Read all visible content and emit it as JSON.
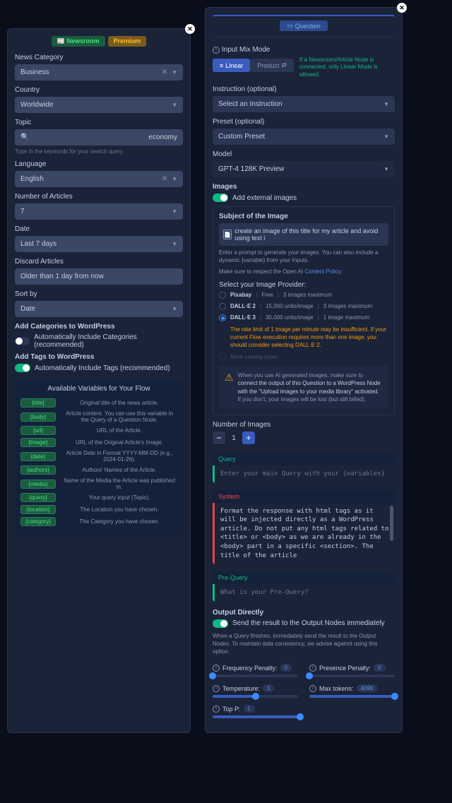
{
  "left": {
    "tabs": {
      "newsroom": "Newsroom",
      "premium": "Premium"
    },
    "category_label": "News Category",
    "category_value": "Business",
    "country_label": "Country",
    "country_value": "Worldwide",
    "topic_label": "Topic",
    "topic_value": "economy",
    "topic_help": "Type in the keywords for your search query",
    "language_label": "Language",
    "language_value": "English",
    "num_articles_label": "Number of Articles",
    "num_articles_value": "7",
    "date_label": "Date",
    "date_value": "Last 7 days",
    "discard_label": "Discard Articles",
    "discard_value": "Older than 1 day from now",
    "sort_label": "Sort by",
    "sort_value": "Date",
    "add_cat_label": "Add Categories to WordPress",
    "add_cat_toggle": "Automatically Include Categories (recommended)",
    "add_tags_label": "Add Tags to WordPress",
    "add_tags_toggle": "Automatically Include Tags (recommended)",
    "vars_title": "Available Variables for Your Flow",
    "vars": [
      {
        "name": "{title}",
        "desc": "Original title of the news article."
      },
      {
        "name": "{body}",
        "desc": "Article content. You can use this variable in the Query of a Question Node."
      },
      {
        "name": "{url}",
        "desc": "URL of the Article."
      },
      {
        "name": "{image}",
        "desc": "URL of the Original Article's Image."
      },
      {
        "name": "{date}",
        "desc": "Article Date in Format YYYY-MM-DD (e.g., 2024-01-26)."
      },
      {
        "name": "{authors}",
        "desc": "Authors' Names of the Article."
      },
      {
        "name": "{media}",
        "desc": "Name of the Media the Article was published in."
      },
      {
        "name": "{query}",
        "desc": "Your query input (Topic)."
      },
      {
        "name": "{location}",
        "desc": "The Location you have chosen."
      },
      {
        "name": "{category}",
        "desc": "The Category you have chosen."
      }
    ]
  },
  "right": {
    "header": "Question",
    "mix_label": "Input Mix Mode",
    "mode_linear": "Linear",
    "mode_product": "Product",
    "mode_note": "If a Newsroom/Article Node is connected, only Linear Mode is allowed.",
    "instruction_label": "Instruction (optional)",
    "instruction_value": "Select an Instruction",
    "preset_label": "Preset (optional)",
    "preset_value": "Custom Preset",
    "model_label": "Model",
    "model_value": "GPT-4 128K Preview",
    "images_label": "Images",
    "images_toggle": "Add external images",
    "subject_label": "Subject of the Image",
    "subject_value": "create an image of this title for my article and avoid using text i",
    "subject_help1": "Enter a prompt to generate your images. You can also include a dynamic {variable} from your Inputs.",
    "subject_help2a": "Make sure to respect the Open AI ",
    "subject_help2b": "Content Policy",
    "provider_label": "Select your Image Provider:",
    "providers": [
      {
        "name": "Pixabay",
        "cost": "Free",
        "max": "3 images maximum"
      },
      {
        "name": "DALL·E 2",
        "cost": "15,000 units/image",
        "max": "3 images maximum"
      },
      {
        "name": "DALL·E 3",
        "cost": "30,000 units/image",
        "max": "1 image maximum"
      }
    ],
    "rate_warning": "The rate limit of 1 image per minute may be insufficient. If your current Flow execution requires more than one image, you should consider selecting DALL·E 2.",
    "coming_soon": "More coming soon.",
    "warn1": "When you use AI generated images, make sure to ",
    "warn2": "connect the output of this Question to a WordPress Node with the \"Upload images to your media library\" activated",
    "warn3": ". If you don't, your images will be lost (but still billed).",
    "num_images_label": "Number of Images",
    "num_images_value": "1",
    "query_label": "Query",
    "query_placeholder": "Enter your main Query with your {variables}",
    "system_label": "System",
    "system_text": "Format the response with html tags as it will be injected directly as a WordPress article. Do not put any html tags related to <title> or <body> as we are already in the <body> part in a specific <section>. The title of the article",
    "prequery_label": "Pre-Query",
    "prequery_placeholder": "What is your Pre-Query?",
    "output_label": "Output Directly",
    "output_toggle": "Send the result to the Output Nodes immediately",
    "output_help": "When a Query finishes, immediately send the result to the Output Nodes. To maintain data consistency, we advise against using this option.",
    "sliders": {
      "freq_label": "Frequency Penalty:",
      "freq_val": "0",
      "pres_label": "Presence Penalty:",
      "pres_val": "0",
      "temp_label": "Temperature:",
      "temp_val": "1",
      "tokens_label": "Max tokens:",
      "tokens_val": "4096",
      "topp_label": "Top P:",
      "topp_val": "1"
    }
  }
}
